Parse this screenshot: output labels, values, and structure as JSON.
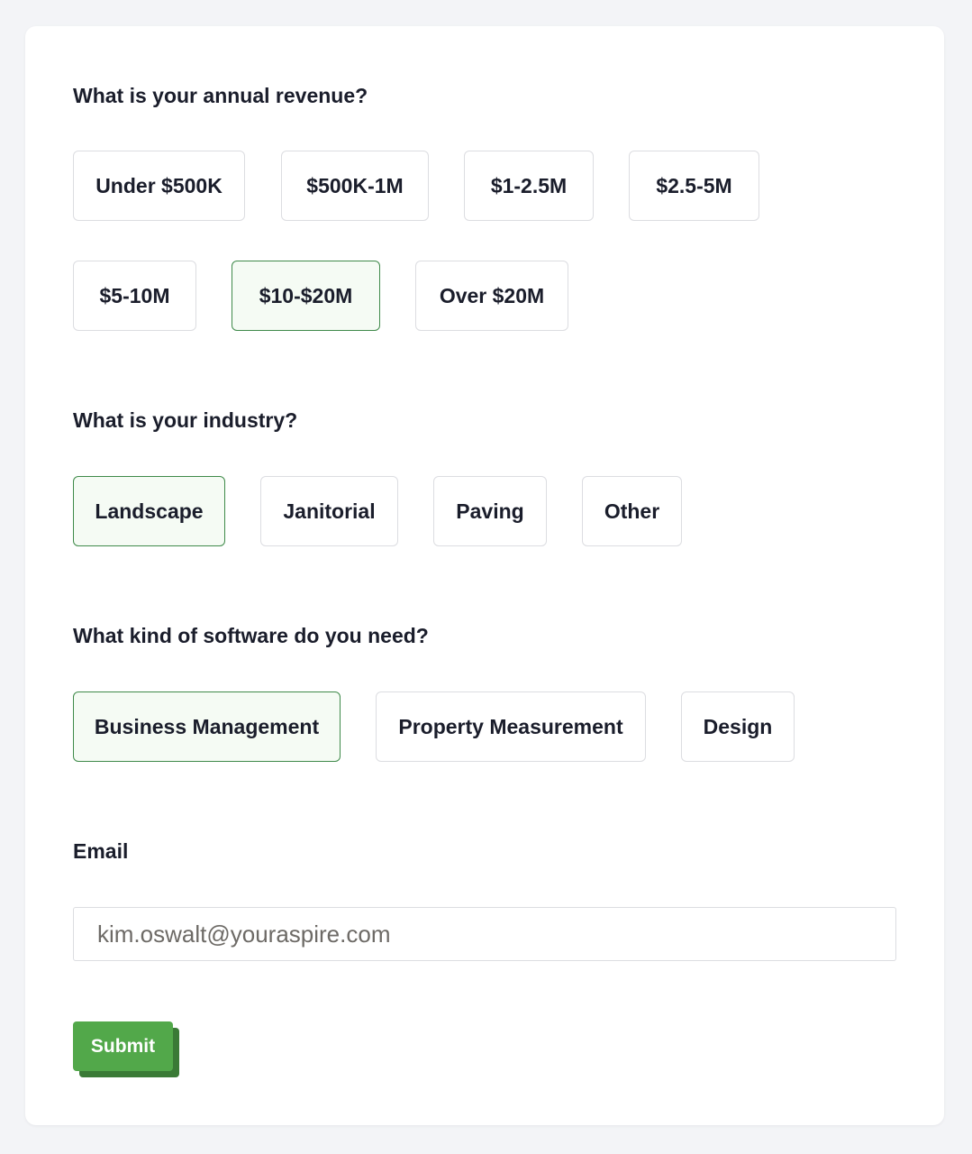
{
  "revenue": {
    "question": "What is your annual revenue?",
    "options": [
      "Under $500K",
      "$500K-1M",
      "$1-2.5M",
      "$2.5-5M",
      "$5-10M",
      "$10-$20M",
      "Over $20M"
    ],
    "selected": "$10-$20M"
  },
  "industry": {
    "question": "What is your industry?",
    "options": [
      "Landscape",
      "Janitorial",
      "Paving",
      "Other"
    ],
    "selected": "Landscape"
  },
  "software": {
    "question": "What kind of software do you need?",
    "options": [
      "Business Management",
      "Property Measurement",
      "Design"
    ],
    "selected": "Business Management"
  },
  "email": {
    "label": "Email",
    "value": "kim.oswalt@youraspire.com"
  },
  "submit": {
    "label": "Submit"
  },
  "colors": {
    "accent": "#52a84a",
    "accent_shadow": "#3a7a36",
    "selected_border": "#3f8a4a",
    "selected_bg": "#f5fbf4",
    "page_bg": "#f3f4f7"
  }
}
